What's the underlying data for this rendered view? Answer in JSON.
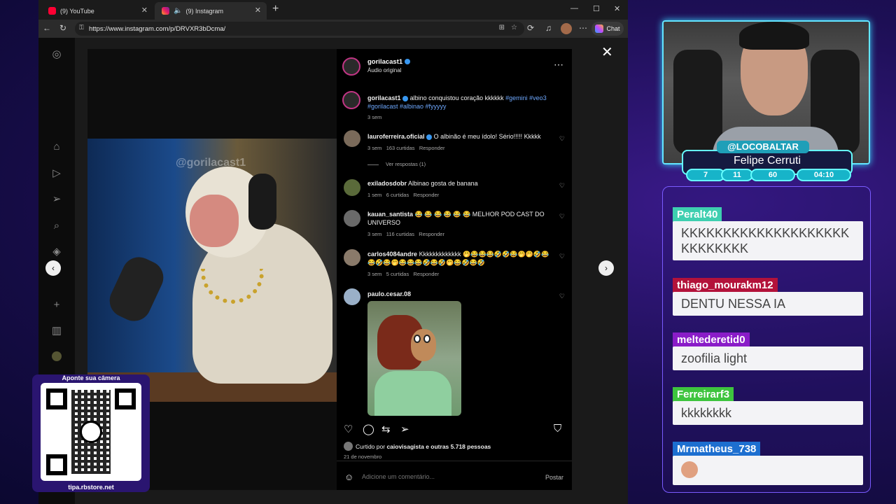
{
  "browser": {
    "tabs": [
      {
        "label": "(9) YouTube",
        "active": false
      },
      {
        "label": "(9) Instagram",
        "active": true
      }
    ],
    "url": "https://www.instagram.com/p/DRVXR3bDcma/",
    "chat_label": "Chat"
  },
  "post": {
    "author": "gorilacast1",
    "audio": "Áudio original",
    "watermark": "@gorilacast1",
    "caption_user": "gorilacast1",
    "caption_text": "albino conquistou coração kkkkkk",
    "caption_tags": "#gemini #veo3 #gorilacast #albinao #fyyyyy",
    "caption_time": "3 sem",
    "comments": [
      {
        "user": "lauroferreira.oficial",
        "verified": true,
        "text": "O albinão é meu ídolo! Sério!!!!! Kkkkk",
        "time": "3 sem",
        "likes": "163 curtidas",
        "reply": "Responder",
        "replies": "Ver respostas (1)"
      },
      {
        "user": "exiladosdobr",
        "verified": false,
        "text": "Albinao gosta de banana",
        "time": "1 sem",
        "likes": "6 curtidas",
        "reply": "Responder"
      },
      {
        "user": "kauan_santista",
        "verified": false,
        "text": "😂 😂 😂 😂 😂 😂 MELHOR POD CAST DO UNIVERSO",
        "time": "3 sem",
        "likes": "116 curtidas",
        "reply": "Responder"
      },
      {
        "user": "carlos4084andre",
        "verified": false,
        "text": "Kkkkkkkkkkkkk 🤭😂😂😂🤣🤣😂🤭🤭🤣😂😂🤣😂🤭😂😂😂🤣😂🤣🤭😂🤣😂🤣",
        "time": "3 sem",
        "likes": "5 curtidas",
        "reply": "Responder"
      },
      {
        "user": "paulo.cesar.08",
        "verified": false,
        "text": ""
      }
    ],
    "liked_by_prefix": "Curtido por",
    "liked_by_user": "caiovisagista",
    "liked_by_suffix": "e outras 5.718 pessoas",
    "date": "21 de novembro",
    "comment_placeholder": "Adicione um comentário...",
    "post_button": "Postar"
  },
  "overlay": {
    "qr_title": "Aponte sua câmera",
    "qr_url": "tipa.rbstore.net",
    "streamer_handle": "@LOCOBALTAR",
    "streamer_name": "Felipe Cerruti",
    "stats": [
      "7",
      "11",
      "60",
      "04:10"
    ]
  },
  "chat": [
    {
      "user": "Peralt40",
      "color": "#3ecfb0",
      "text": "KKKKKKKKKKKKKKKKKKKKKKKKKKKK"
    },
    {
      "user": "thiago_mourakm12",
      "color": "#b3123a",
      "text": "DENTU NESSA IA"
    },
    {
      "user": "meltederetid0",
      "color": "#8a1cc8",
      "text": "zoofilia light"
    },
    {
      "user": "Ferreirarf3",
      "color": "#3ec43e",
      "text": "kkkkkkkk"
    },
    {
      "user": "Mrmatheus_738",
      "color": "#1d6fd0",
      "text": ""
    }
  ],
  "colors": {
    "accent": "#63e6ff",
    "link": "#6ea8fe",
    "verified": "#3897f0"
  }
}
